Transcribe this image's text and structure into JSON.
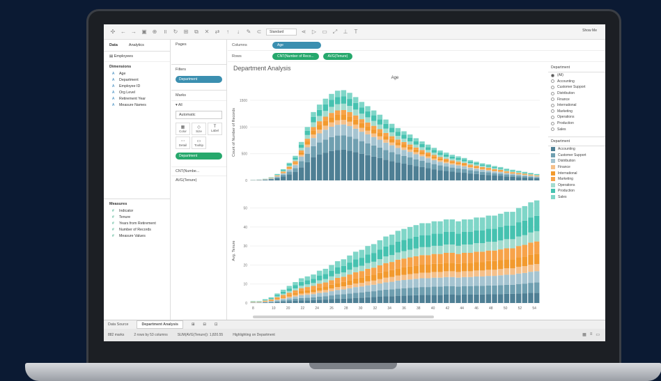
{
  "toolbar": {
    "icons": [
      "tableau-icon",
      "back-icon",
      "forward-icon",
      "save-icon",
      "new-datasource-icon",
      "pause-icon",
      "refresh-icon",
      "new-sheet-icon",
      "duplicate-icon",
      "clear-icon",
      "swap-icon",
      "sort-asc-icon",
      "sort-desc-icon",
      "highlight-icon",
      "group-icon",
      "label-icon",
      "fix-axes-icon",
      "fit-icon",
      "tooltip-icon",
      "present-icon",
      "share-icon"
    ],
    "fit_select": "Standard",
    "show_me": "Show Me"
  },
  "left_pane": {
    "tabs": [
      "Data",
      "Analytics"
    ],
    "datasource": "Employees",
    "dimensions_header": "Dimensions",
    "dimensions": [
      "Age",
      "Department",
      "Employee ID",
      "Org Level",
      "Retirement Year",
      "Measure Names"
    ],
    "measures_header": "Measures",
    "measures": [
      "Indicator",
      "Tenure",
      "Years from Retirement",
      "Number of Records",
      "Measure Values"
    ]
  },
  "cards": {
    "pages": "Pages",
    "filters": "Filters",
    "filter_pill": "Department",
    "marks": "Marks",
    "all": "All",
    "mark_type": "Automatic",
    "mark_buttons": [
      "Color",
      "Size",
      "Label",
      "Detail",
      "Tooltip"
    ],
    "color_pill": "Department",
    "mark_rows": [
      "CNT(Numbe...",
      "AVG(Tenure)"
    ]
  },
  "shelves": {
    "columns_label": "Columns",
    "columns_pill": "Age",
    "rows_label": "Rows",
    "rows_pills": [
      "CNT(Number of Reco...",
      "AVG(Tenure)"
    ]
  },
  "viz": {
    "title": "Department Analysis",
    "column_header": "Age"
  },
  "chart_data": {
    "type": "bar",
    "stacked": true,
    "x": [
      8,
      9,
      10,
      11,
      12,
      13,
      14,
      15,
      16,
      17,
      18,
      19,
      20,
      21,
      22,
      23,
      24,
      25,
      26,
      27,
      28,
      29,
      30,
      31,
      32,
      33,
      34,
      35,
      36,
      37,
      38,
      39,
      40,
      41,
      42,
      43,
      44,
      45,
      46,
      47,
      48,
      49,
      50,
      51,
      52,
      53,
      54,
      55
    ],
    "x_tick_labels": [
      "8",
      "10",
      "20",
      "22",
      "24",
      "26",
      "28",
      "30",
      "32",
      "34",
      "36",
      "38",
      "40",
      "42",
      "44",
      "46",
      "48",
      "50",
      "52",
      "54"
    ],
    "series": [
      {
        "name": "Accounting",
        "color": "#4e7f94"
      },
      {
        "name": "Customer Support",
        "color": "#6f9fb0"
      },
      {
        "name": "Distribution",
        "color": "#a5c4d1"
      },
      {
        "name": "Finance",
        "color": "#f5c08a"
      },
      {
        "name": "International",
        "color": "#f29a2e"
      },
      {
        "name": "Marketing",
        "color": "#f7a34a"
      },
      {
        "name": "Operations",
        "color": "#a3dccf"
      },
      {
        "name": "Production",
        "color": "#46c2b0"
      },
      {
        "name": "Sales",
        "color": "#7fd6c8"
      }
    ],
    "panels": [
      {
        "ylabel": "Count of Number of Records",
        "yticks": [
          0,
          500,
          1000,
          1500
        ],
        "ylim": [
          0,
          1800
        ],
        "totals": [
          10,
          15,
          30,
          60,
          120,
          210,
          330,
          460,
          720,
          1000,
          1280,
          1420,
          1530,
          1620,
          1680,
          1690,
          1640,
          1560,
          1470,
          1390,
          1310,
          1230,
          1140,
          1060,
          980,
          920,
          860,
          790,
          730,
          670,
          610,
          560,
          520,
          480,
          450,
          420,
          380,
          350,
          320,
          300,
          270,
          250,
          220,
          200,
          180,
          160,
          140,
          120
        ],
        "share": {
          "Accounting": 0.34,
          "Customer Support": 0.16,
          "Distribution": 0.12,
          "Finance": 0.05,
          "International": 0.06,
          "Marketing": 0.05,
          "Operations": 0.07,
          "Production": 0.08,
          "Sales": 0.07
        }
      },
      {
        "ylabel": "Avg. Tenure",
        "yticks": [
          0,
          10,
          20,
          30,
          40,
          50
        ],
        "ylim": [
          0,
          55
        ],
        "totals": [
          1,
          1,
          2,
          3,
          5,
          7,
          9,
          11,
          13,
          14,
          15,
          17,
          18,
          20,
          22,
          23,
          25,
          27,
          28,
          30,
          31,
          33,
          35,
          36,
          38,
          39,
          40,
          41,
          42,
          42,
          43,
          43,
          44,
          44,
          43,
          44,
          44,
          45,
          45,
          46,
          46,
          47,
          48,
          48,
          50,
          51,
          53,
          54
        ],
        "share": {
          "Accounting": 0.1,
          "Customer Support": 0.1,
          "Distribution": 0.11,
          "Finance": 0.07,
          "International": 0.1,
          "Marketing": 0.12,
          "Operations": 0.1,
          "Production": 0.15,
          "Sales": 0.15
        }
      }
    ]
  },
  "legend_filter": {
    "header": "Department",
    "items": [
      "(All)",
      "Accounting",
      "Customer Support",
      "Distribution",
      "Finance",
      "International",
      "Marketing",
      "Operations",
      "Production",
      "Sales"
    ]
  },
  "legend_color": {
    "header": "Department",
    "items": [
      "Accounting",
      "Customer Support",
      "Distribution",
      "Finance",
      "International",
      "Marketing",
      "Operations",
      "Production",
      "Sales"
    ]
  },
  "tabs": {
    "data_source": "Data Source",
    "sheet": "Department Analysis"
  },
  "status": {
    "marks": "882 marks",
    "rows_cols": "2 rows by 53 columns",
    "sum": "SUM(AVG(Tenure)): 1,820.55",
    "highlight": "Highlighting on Department"
  }
}
